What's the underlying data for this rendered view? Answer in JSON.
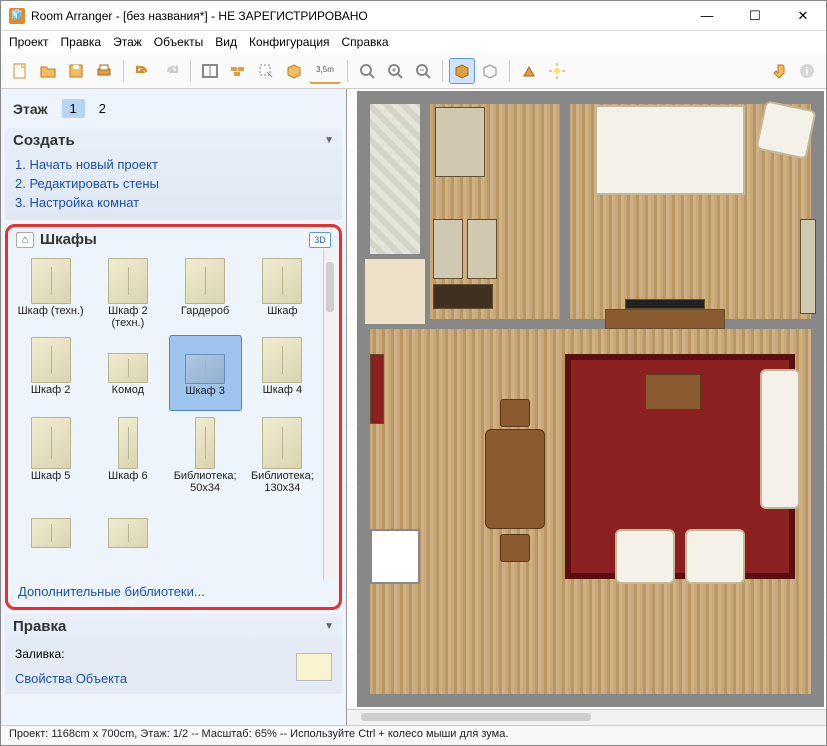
{
  "titlebar": {
    "text": "Room Arranger - [без названия*] - НЕ ЗАРЕГИСТРИРОВАНО"
  },
  "menu": {
    "items": [
      "Проект",
      "Правка",
      "Этаж",
      "Объекты",
      "Вид",
      "Конфигурация",
      "Справка"
    ]
  },
  "floors": {
    "label": "Этаж",
    "tabs": [
      "1",
      "2"
    ],
    "selected": 0
  },
  "create": {
    "title": "Создать",
    "steps": [
      "1. Начать новый проект",
      "2. Редактировать стены",
      "3. Настройка комнат"
    ]
  },
  "library": {
    "title": "Шкафы",
    "btn3d": "3D",
    "items": [
      "Шкаф (техн.)",
      "Шкаф 2 (техн.)",
      "Гардероб",
      "Шкаф",
      "Шкаф 2",
      "Комод",
      "Шкаф 3",
      "Шкаф 4",
      "Шкаф 5",
      "Шкаф 6",
      "Библиотека; 50x34",
      "Библиотека; 130x34"
    ],
    "selected": 6,
    "more_link": "Дополнительные библиотеки..."
  },
  "edit": {
    "title": "Правка",
    "fill_label": "Заливка:",
    "props_link": "Свойства Объекта"
  },
  "statusbar": "Проект: 1168cm x 700cm, Этаж: 1/2 -- Масштаб: 65% -- Используйте Ctrl + колесо мыши для зума."
}
